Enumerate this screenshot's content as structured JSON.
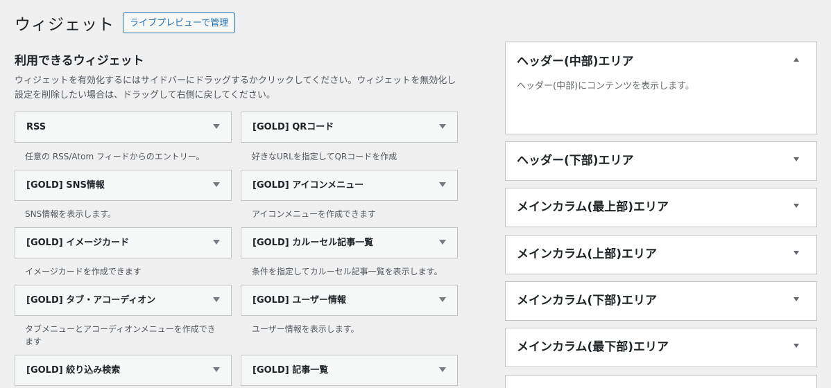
{
  "header": {
    "title": "ウィジェット",
    "live_preview_label": "ライブプレビューで管理"
  },
  "available": {
    "title": "利用できるウィジェット",
    "description": "ウィジェットを有効化するにはサイドバーにドラッグするかクリックしてください。ウィジェットを無効化し設定を削除したい場合は、ドラッグして右側に戻してください。"
  },
  "widgets": [
    {
      "name": "RSS",
      "desc": "任意の RSS/Atom フィードからのエントリー。"
    },
    {
      "name": "[GOLD] QRコード",
      "desc": "好きなURLを指定してQRコードを作成"
    },
    {
      "name": "[GOLD] SNS情報",
      "desc": "SNS情報を表示します。"
    },
    {
      "name": "[GOLD] アイコンメニュー",
      "desc": "アイコンメニューを作成できます"
    },
    {
      "name": "[GOLD] イメージカード",
      "desc": "イメージカードを作成できます"
    },
    {
      "name": "[GOLD] カルーセル記事一覧",
      "desc": "条件を指定してカルーセル記事一覧を表示します。"
    },
    {
      "name": "[GOLD] タブ・アコーディオン",
      "desc": "タブメニューとアコーディオンメニューを作成できます"
    },
    {
      "name": "[GOLD] ユーザー情報",
      "desc": "ユーザー情報を表示します。"
    },
    {
      "name": "[GOLD] 絞り込み検索",
      "desc": ""
    },
    {
      "name": "[GOLD] 記事一覧",
      "desc": ""
    }
  ],
  "areas": [
    {
      "title": "ヘッダー(中部)エリア",
      "desc": "ヘッダー(中部)にコンテンツを表示します。",
      "expanded": true
    },
    {
      "title": "ヘッダー(下部)エリア",
      "expanded": false
    },
    {
      "title": "メインカラム(最上部)エリア",
      "expanded": false
    },
    {
      "title": "メインカラム(上部)エリア",
      "expanded": false
    },
    {
      "title": "メインカラム(下部)エリア",
      "expanded": false
    },
    {
      "title": "メインカラム(最下部)エリア",
      "expanded": false
    }
  ]
}
